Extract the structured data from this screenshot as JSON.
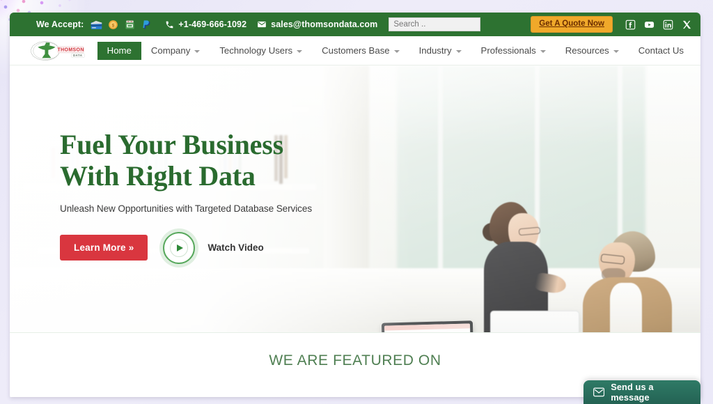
{
  "topbar": {
    "we_accept_label": "We Accept:",
    "payment_icons": [
      "credit-card-icon",
      "coin-icon",
      "bank-atm-icon",
      "paypal-icon"
    ],
    "phone": "+1-469-666-1092",
    "email": "sales@thomsondata.com",
    "search_placeholder": "Search ..",
    "search_value": "",
    "quote_button": "Get A Quote Now",
    "socials": [
      "facebook-icon",
      "youtube-icon",
      "linkedin-icon",
      "x-twitter-icon"
    ],
    "bg_color": "#2d7231",
    "quote_color": "#f0a92a"
  },
  "nav": {
    "logo_primary": "THOMSON",
    "logo_secondary": "DATA",
    "items": [
      {
        "label": "Home",
        "has_dropdown": false,
        "active": true
      },
      {
        "label": "Company",
        "has_dropdown": true,
        "active": false
      },
      {
        "label": "Technology Users",
        "has_dropdown": true,
        "active": false
      },
      {
        "label": "Customers Base",
        "has_dropdown": true,
        "active": false
      },
      {
        "label": "Industry",
        "has_dropdown": true,
        "active": false
      },
      {
        "label": "Professionals",
        "has_dropdown": true,
        "active": false
      },
      {
        "label": "Resources",
        "has_dropdown": true,
        "active": false
      },
      {
        "label": "Contact Us",
        "has_dropdown": false,
        "active": false
      }
    ]
  },
  "hero": {
    "title": "Fuel Your Business\nWith Right Data",
    "subtitle": "Unleash New Opportunities with Targeted Database Services",
    "primary_cta": "Learn More »",
    "video_cta": "Watch Video",
    "title_color": "#2a6b2f",
    "cta_color": "#d9363f"
  },
  "featured": {
    "title": "WE ARE FEATURED ON",
    "title_color": "#4f7f52"
  },
  "chat": {
    "label": "Send us a message",
    "icon": "envelope-icon",
    "bg_color": "#2f7a66"
  }
}
